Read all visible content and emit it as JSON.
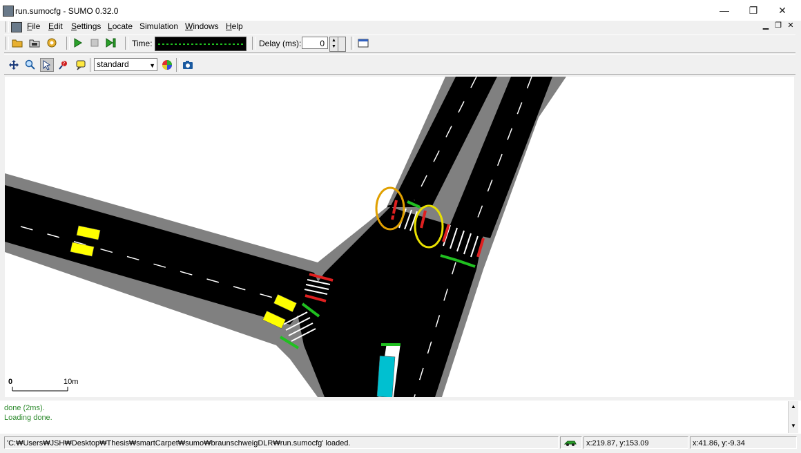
{
  "window": {
    "title": "run.sumocfg - SUMO 0.32.0",
    "minimize": "—",
    "restore": "❐",
    "close": "✕"
  },
  "menu": {
    "items": [
      {
        "label": "File",
        "accel": "F"
      },
      {
        "label": "Edit",
        "accel": "E"
      },
      {
        "label": "Settings",
        "accel": "S"
      },
      {
        "label": "Locate",
        "accel": "L"
      },
      {
        "label": "Simulation",
        "accel": ""
      },
      {
        "label": "Windows",
        "accel": "W"
      },
      {
        "label": "Help",
        "accel": "H"
      }
    ],
    "mdi": {
      "minimize": "▁",
      "restore": "❐",
      "close": "✕"
    }
  },
  "toolbar": {
    "time_label": "Time:",
    "delay_label": "Delay (ms):",
    "delay_value": "0"
  },
  "view_toolbar": {
    "scheme_value": "standard"
  },
  "view": {
    "scale_start": "0",
    "scale_end": "10m",
    "marker_1": "1",
    "marker_2": "2",
    "colors": {
      "road": "#000000",
      "sidewalk": "#808080",
      "vehicle": "#ffff00",
      "bus": "#00c0d0",
      "signal_red": "#e02020",
      "signal_green": "#20c020",
      "marker": "#e0a000"
    }
  },
  "messages": [
    "done (2ms).",
    "Loading done."
  ],
  "status": {
    "loaded": "'C:₩Users₩JSH₩Desktop₩Thesis₩smartCarpet₩sumo₩braunschweigDLR₩run.sumocfg' loaded.",
    "coords_net": "x:219.87, y:153.09",
    "coords_geo": "x:41.86, y:-9.34"
  }
}
